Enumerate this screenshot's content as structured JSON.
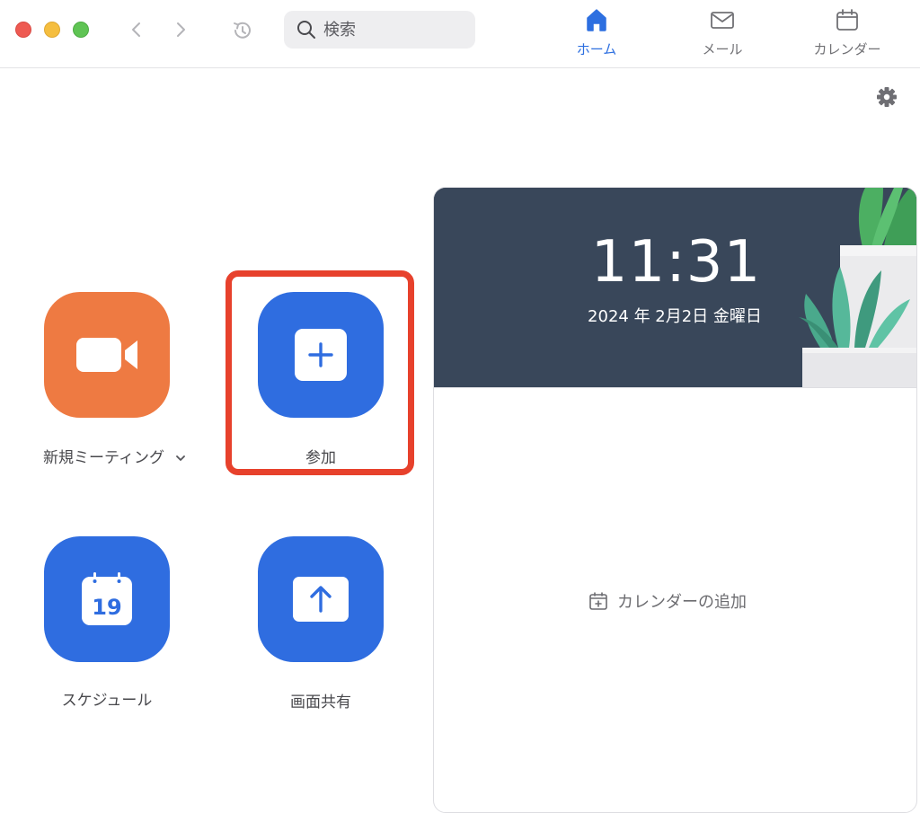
{
  "toolbar": {
    "search_placeholder": "検索"
  },
  "tabs": [
    {
      "label": "ホーム",
      "icon": "home-icon",
      "active": true
    },
    {
      "label": "メール",
      "icon": "mail-icon",
      "active": false
    },
    {
      "label": "カレンダー",
      "icon": "calendar-icon",
      "active": false
    }
  ],
  "actions": {
    "new_meeting": {
      "label": "新規ミーティング",
      "icon": "video-camera-icon"
    },
    "join": {
      "label": "参加",
      "icon": "plus-icon"
    },
    "schedule": {
      "label": "スケジュール",
      "icon": "calendar-icon",
      "day": "19"
    },
    "share": {
      "label": "画面共有",
      "icon": "upload-arrow-icon"
    }
  },
  "panel": {
    "time": "11:31",
    "date": "2024 年 2月2日 金曜日",
    "add_calendar_label": "カレンダーの追加"
  },
  "colors": {
    "accent": "#2d6fe0",
    "orange": "#ee7a42",
    "highlight": "#e7412c",
    "hero": "#3a4657"
  }
}
